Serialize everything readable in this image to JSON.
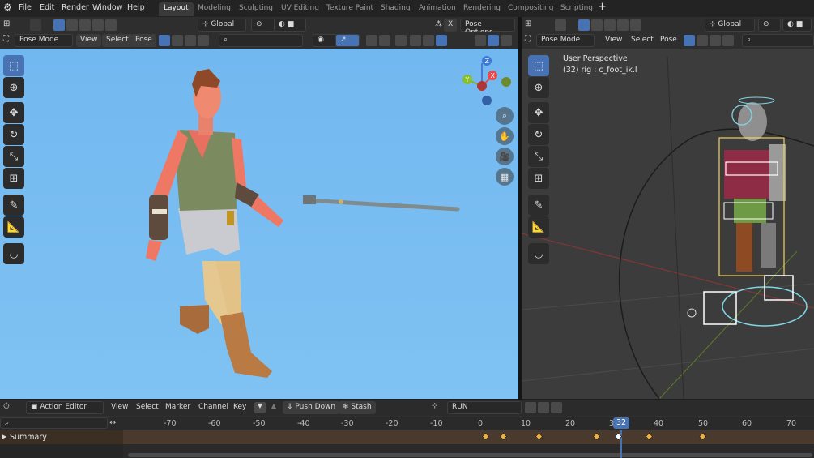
{
  "menu": [
    "File",
    "Edit",
    "Render",
    "Window",
    "Help"
  ],
  "workspaces": [
    "Layout",
    "Modeling",
    "Sculpting",
    "UV Editing",
    "Texture Paint",
    "Shading",
    "Animation",
    "Rendering",
    "Compositing",
    "Scripting"
  ],
  "active_workspace": "Layout",
  "header": {
    "orientation": "Global",
    "pose_options": "Pose Options",
    "x_label": "X"
  },
  "left_viewport": {
    "mode": "Pose Mode",
    "menus": [
      "View",
      "Select",
      "Pose"
    ],
    "gizmo": {
      "x": "X",
      "y": "Y",
      "z": "Z"
    }
  },
  "right_viewport": {
    "mode": "Pose Mode",
    "menus": [
      "View",
      "Select",
      "Pose"
    ],
    "orientation": "Global",
    "overlay_title": "User Perspective",
    "overlay_sub": "(32) rig : c_foot_ik.l"
  },
  "action_editor": {
    "mode": "Action Editor",
    "menus": [
      "View",
      "Select",
      "Marker",
      "Channel",
      "Key"
    ],
    "push_down": "Push Down",
    "stash": "Stash",
    "action_name": "RUN",
    "current_frame": "32",
    "ruler": [
      "-70",
      "-60",
      "-50",
      "-40",
      "-30",
      "-20",
      "-10",
      "0",
      "10",
      "20",
      "3",
      "40",
      "50",
      "60",
      "70"
    ],
    "channel": "Summary",
    "keyframes": [
      1,
      5,
      13,
      26,
      31,
      38,
      50
    ],
    "selected_keyframe": 31
  },
  "colors": {
    "accent": "#4772b3",
    "keyframe": "#f0b23a",
    "viewport_sky": "#7fc2f3",
    "viewport_dark": "#3c3c3c"
  }
}
